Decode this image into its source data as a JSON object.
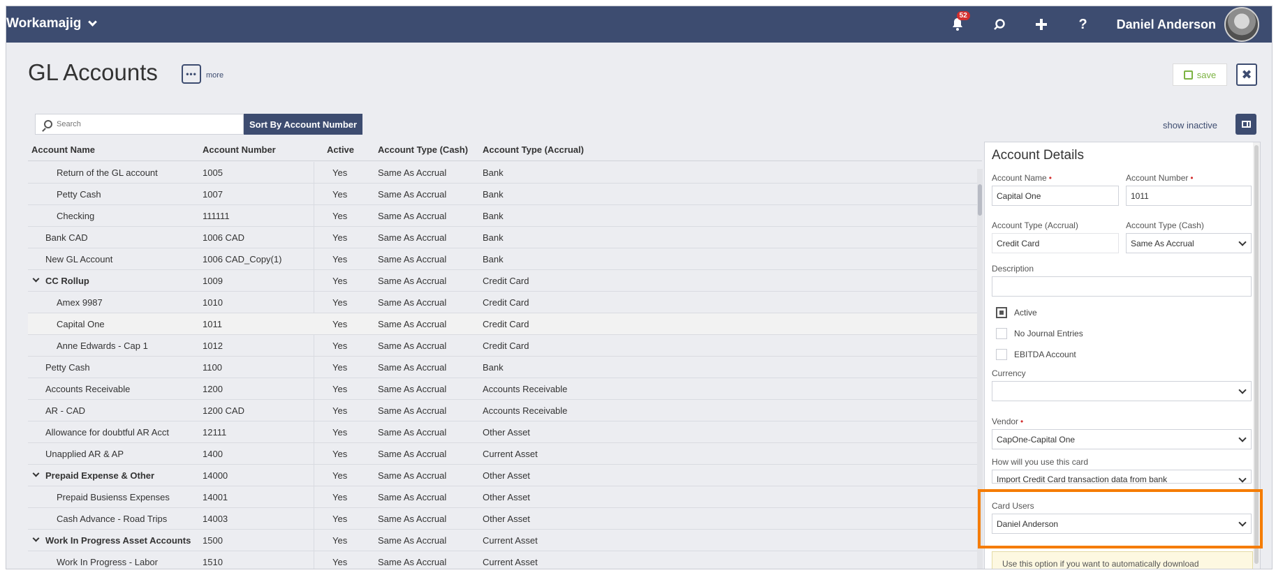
{
  "topbar": {
    "brand": "Workamajig",
    "notification_count": "52",
    "user_name": "Daniel Anderson"
  },
  "page": {
    "title": "GL Accounts",
    "more_label": "more",
    "save_label": "save"
  },
  "toolbar": {
    "search_placeholder": "Search",
    "sort_label": "Sort By Account Number",
    "show_inactive_label": "show inactive"
  },
  "table": {
    "headers": [
      "Account Name",
      "Account Number",
      "Active",
      "Account Type (Cash)",
      "Account Type (Accrual)"
    ],
    "rows": [
      {
        "name": "Return of the GL account",
        "num": "1005",
        "active": "Yes",
        "cash": "Same As Accrual",
        "accrual": "Bank"
      },
      {
        "name": "Petty Cash",
        "num": "1007",
        "active": "Yes",
        "cash": "Same As Accrual",
        "accrual": "Bank"
      },
      {
        "name": "Checking",
        "num": "111111",
        "active": "Yes",
        "cash": "Same As Accrual",
        "accrual": "Bank"
      },
      {
        "name": "Bank CAD",
        "num": "1006 CAD",
        "active": "Yes",
        "cash": "Same As Accrual",
        "accrual": "Bank"
      },
      {
        "name": "New GL Account",
        "num": "1006 CAD_Copy(1)",
        "active": "Yes",
        "cash": "Same As Accrual",
        "accrual": "Bank"
      },
      {
        "name": "CC Rollup",
        "num": "1009",
        "active": "Yes",
        "cash": "Same As Accrual",
        "accrual": "Credit Card"
      },
      {
        "name": "Amex 9987",
        "num": "1010",
        "active": "Yes",
        "cash": "Same As Accrual",
        "accrual": "Credit Card"
      },
      {
        "name": "Capital One",
        "num": "1011",
        "active": "Yes",
        "cash": "Same As Accrual",
        "accrual": "Credit Card"
      },
      {
        "name": "Anne Edwards - Cap 1",
        "num": "1012",
        "active": "Yes",
        "cash": "Same As Accrual",
        "accrual": "Credit Card"
      },
      {
        "name": "Petty Cash",
        "num": "1100",
        "active": "Yes",
        "cash": "Same As Accrual",
        "accrual": "Bank"
      },
      {
        "name": "Accounts Receivable",
        "num": "1200",
        "active": "Yes",
        "cash": "Same As Accrual",
        "accrual": "Accounts Receivable"
      },
      {
        "name": "AR - CAD",
        "num": "1200 CAD",
        "active": "Yes",
        "cash": "Same As Accrual",
        "accrual": "Accounts Receivable"
      },
      {
        "name": "Allowance for doubtful AR Acct",
        "num": "12111",
        "active": "Yes",
        "cash": "Same As Accrual",
        "accrual": "Other Asset"
      },
      {
        "name": "Unapplied AR & AP",
        "num": "1400",
        "active": "Yes",
        "cash": "Same As Accrual",
        "accrual": "Current Asset"
      },
      {
        "name": "Prepaid Expense & Other",
        "num": "14000",
        "active": "Yes",
        "cash": "Same As Accrual",
        "accrual": "Other Asset"
      },
      {
        "name": "Prepaid Busienss Expenses",
        "num": "14001",
        "active": "Yes",
        "cash": "Same As Accrual",
        "accrual": "Other Asset"
      },
      {
        "name": "Cash Advance - Road Trips",
        "num": "14003",
        "active": "Yes",
        "cash": "Same As Accrual",
        "accrual": "Other Asset"
      },
      {
        "name": "Work In Progress Asset Accounts",
        "num": "1500",
        "active": "Yes",
        "cash": "Same As Accrual",
        "accrual": "Current Asset"
      },
      {
        "name": "Work In Progress - Labor",
        "num": "1510",
        "active": "Yes",
        "cash": "Same As Accrual",
        "accrual": "Current Asset"
      }
    ]
  },
  "details": {
    "title": "Account Details",
    "account_name_label": "Account Name",
    "account_name_value": "Capital One",
    "account_number_label": "Account Number",
    "account_number_value": "1011",
    "type_accrual_label": "Account Type (Accrual)",
    "type_accrual_value": "Credit Card",
    "type_cash_label": "Account Type (Cash)",
    "type_cash_value": "Same As Accrual",
    "description_label": "Description",
    "description_value": "",
    "active_label": "Active",
    "no_journal_label": "No Journal Entries",
    "ebitda_label": "EBITDA Account",
    "currency_label": "Currency",
    "currency_value": "",
    "vendor_label": "Vendor",
    "vendor_value": "CapOne-Capital One",
    "usage_label": "How will you use this card",
    "usage_value": "Import Credit Card transaction data from bank",
    "card_users_label": "Card Users",
    "card_users_value": "Daniel Anderson",
    "info_text": "Use this option if you want to automatically download"
  },
  "colors": {
    "brand": "#3d4c70",
    "accent_highlight": "#f57c00",
    "save_green": "#7cb342",
    "badge_red": "#d32f2f"
  }
}
